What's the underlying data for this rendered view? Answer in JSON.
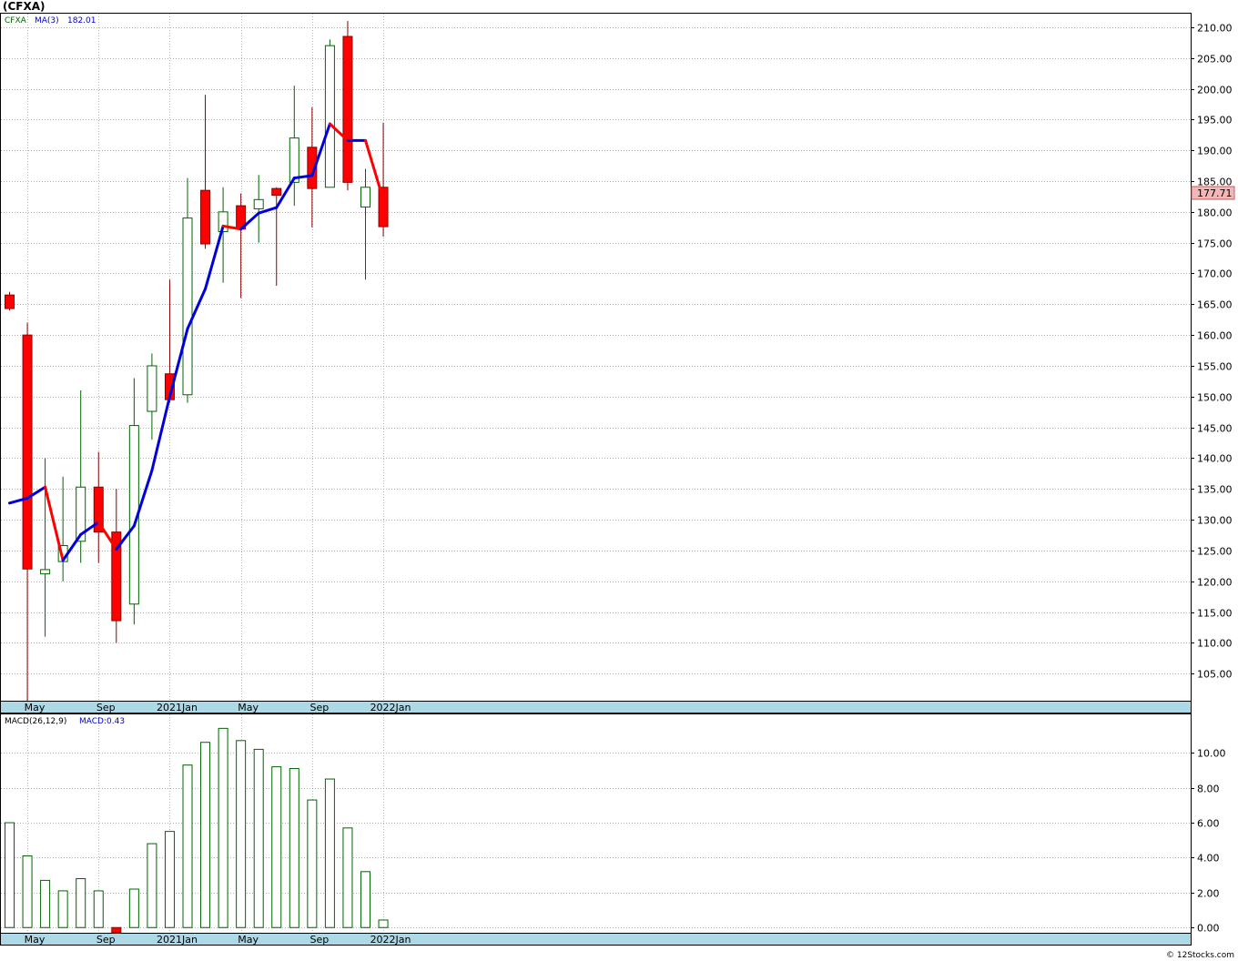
{
  "title": "(CFXA)",
  "footer": "© 12Stocks.com",
  "legend": {
    "symbol": "CFXA",
    "ma_label": "MA(3)",
    "ma_value": "182.01",
    "macd_label": "MACD(26,12,9)",
    "macd_value": "MACD:0.43"
  },
  "last_price_label": "177.71",
  "colors": {
    "up": "#006400",
    "down": "#ff0000",
    "ma_up": "#0000dd",
    "ma_down": "#ff0000",
    "axis_band": "#add8e6",
    "grid": "#999999"
  },
  "chart_data": [
    {
      "type": "candlestick",
      "title": "",
      "x_tick_labels": [
        "May",
        "Sep",
        "2021Jan",
        "May",
        "Sep",
        "2022Jan"
      ],
      "y_tick_labels": [
        "105.00",
        "110.00",
        "115.00",
        "120.00",
        "125.00",
        "130.00",
        "135.00",
        "140.00",
        "145.00",
        "150.00",
        "155.00",
        "160.00",
        "165.00",
        "170.00",
        "175.00",
        "180.00",
        "185.00",
        "190.00",
        "195.00",
        "200.00",
        "205.00",
        "210.00"
      ],
      "ylim": [
        100.6,
        212.2
      ],
      "grid": true,
      "candles": [
        {
          "o": 166.5,
          "h": 167.0,
          "l": 164.0,
          "c": 164.3
        },
        {
          "o": 160.0,
          "h": 162.0,
          "l": 100.6,
          "c": 122.0
        },
        {
          "o": 121.2,
          "h": 140.0,
          "l": 111.0,
          "c": 121.9
        },
        {
          "o": 123.2,
          "h": 137.0,
          "l": 120.0,
          "c": 125.8
        },
        {
          "o": 126.5,
          "h": 151.0,
          "l": 123.0,
          "c": 135.3
        },
        {
          "o": 135.3,
          "h": 141.0,
          "l": 123.0,
          "c": 128.0
        },
        {
          "o": 128.0,
          "h": 135.0,
          "l": 110.0,
          "c": 113.6
        },
        {
          "o": 116.3,
          "h": 153.0,
          "l": 113.0,
          "c": 145.3
        },
        {
          "o": 147.6,
          "h": 157.0,
          "l": 143.0,
          "c": 155.0
        },
        {
          "o": 153.7,
          "h": 169.0,
          "l": 149.0,
          "c": 149.5
        },
        {
          "o": 150.3,
          "h": 185.5,
          "l": 149.0,
          "c": 179.0
        },
        {
          "o": 183.5,
          "h": 199.0,
          "l": 174.0,
          "c": 174.8
        },
        {
          "o": 176.8,
          "h": 184.0,
          "l": 168.5,
          "c": 180.0
        },
        {
          "o": 181.0,
          "h": 183.0,
          "l": 166.0,
          "c": 177.2
        },
        {
          "o": 180.5,
          "h": 186.0,
          "l": 175.0,
          "c": 182.0
        },
        {
          "o": 183.8,
          "h": 184.0,
          "l": 168.0,
          "c": 182.7
        },
        {
          "o": 184.8,
          "h": 200.5,
          "l": 181.0,
          "c": 192.0
        },
        {
          "o": 190.5,
          "h": 197.0,
          "l": 177.5,
          "c": 183.8
        },
        {
          "o": 184.0,
          "h": 208.0,
          "l": 184.0,
          "c": 207.0
        },
        {
          "o": 208.5,
          "h": 211.0,
          "l": 183.5,
          "c": 184.8
        },
        {
          "o": 180.8,
          "h": 187.0,
          "l": 169.0,
          "c": 184.0
        },
        {
          "o": 184.0,
          "h": 194.5,
          "l": 176.0,
          "c": 177.6
        }
      ],
      "ma_series": {
        "name": "MA(3)",
        "values": [
          132.7,
          133.5,
          135.3,
          123.4,
          127.6,
          129.6,
          125.2,
          129.0,
          138.0,
          150.0,
          161.0,
          167.5,
          177.7,
          177.2,
          179.8,
          180.7,
          185.5,
          185.9,
          194.3,
          191.6,
          191.6,
          182.0
        ]
      }
    },
    {
      "type": "bar",
      "title": "MACD(26,12,9)",
      "y_tick_labels": [
        "0.00",
        "2.00",
        "4.00",
        "6.00",
        "8.00",
        "10.00"
      ],
      "ylim": [
        -0.3,
        12.2
      ],
      "grid": true,
      "values": [
        6.0,
        4.1,
        2.7,
        2.1,
        2.8,
        2.1,
        -0.3,
        2.2,
        4.8,
        5.5,
        9.3,
        10.6,
        11.4,
        10.7,
        10.2,
        9.2,
        9.1,
        7.3,
        8.5,
        5.7,
        3.2,
        0.43
      ]
    }
  ]
}
